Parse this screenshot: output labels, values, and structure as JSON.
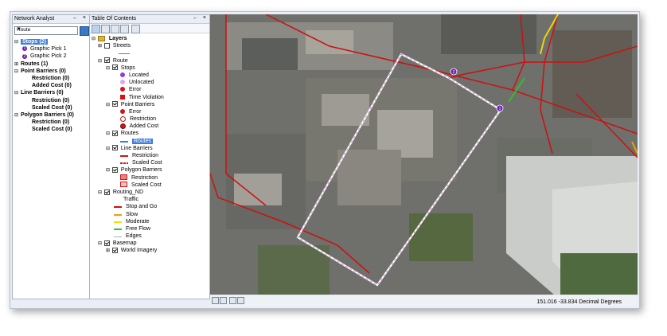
{
  "na": {
    "title": "Network Analyst",
    "controls": "← ×",
    "select_value": "Route",
    "stops_label": "Stops (2)",
    "stops_items": [
      {
        "num": "1",
        "label": "Graphic Pick 1"
      },
      {
        "num": "2",
        "label": "Graphic Pick 2"
      }
    ],
    "routes_label": "Routes (1)",
    "point_barriers_label": "Point Barriers (0)",
    "pb_restriction": "Restriction (0)",
    "pb_added_cost": "Added Cost (0)",
    "line_barriers_label": "Line Barriers (0)",
    "lb_restriction": "Restriction (0)",
    "lb_scaled_cost": "Scaled Cost (0)",
    "polygon_barriers_label": "Polygon Barriers (0)",
    "pg_restriction": "Restriction (0)",
    "pg_scaled_cost": "Scaled Cost (0)"
  },
  "toc": {
    "title": "Table Of Contents",
    "controls": "← ×",
    "layers": "Layers",
    "streets": "Streets",
    "route": "Route",
    "stops": "Stops",
    "located": "Located",
    "unlocated": "Unlocated",
    "error": "Error",
    "time_violation": "Time Violation",
    "point_barriers": "Point Barriers",
    "pb_error": "Error",
    "pb_restriction": "Restriction",
    "pb_added_cost": "Added Cost",
    "routes": "Routes",
    "routes_item": "Routes",
    "line_barriers": "Line Barriers",
    "lb_restriction": "Restriction",
    "lb_scaled_cost": "Scaled Cost",
    "polygon_barriers": "Polygon Barriers",
    "pg_restriction": "Restriction",
    "pg_scaled_cost": "Scaled Cost",
    "routing_nd": "Routing_ND",
    "traffic": "Traffic",
    "stop_and_go": "Stop and Go",
    "slow": "Slow",
    "moderate": "Moderate",
    "free_flow": "Free Flow",
    "edges": "Edges",
    "basemap": "Basemap",
    "world_imagery": "World Imagery"
  },
  "map": {
    "stop1_label": "1",
    "stop2_label": "2"
  },
  "status": {
    "coords": "151.016  -33.834 Decimal Degrees"
  },
  "colors": {
    "selection": "#3c7fd8",
    "stop": "#6a1fb5",
    "street_red": "#cc1010",
    "route_line": "#ffffff",
    "stop_and_go": "#cc1010",
    "slow": "#f0a000",
    "moderate": "#f0e000",
    "free_flow": "#30c030"
  }
}
